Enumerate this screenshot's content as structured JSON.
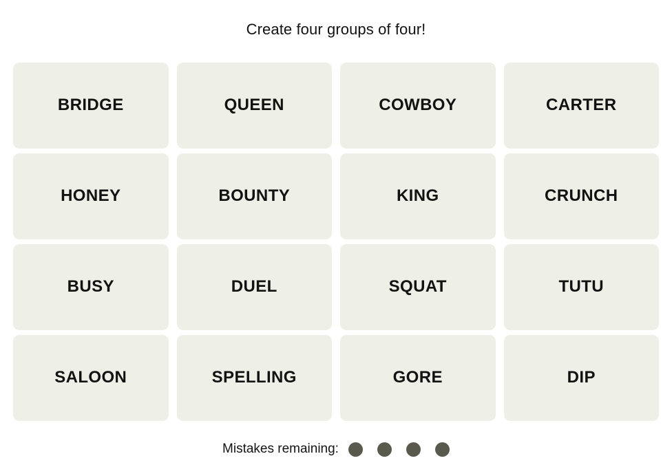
{
  "header": {
    "instruction": "Create four groups of four!"
  },
  "board": {
    "columns": 4,
    "rows": 4,
    "tile_bg_color": "#eeefe6",
    "tile_text_color": "#121212",
    "tiles": [
      {
        "word": "BRIDGE",
        "selected": false
      },
      {
        "word": "QUEEN",
        "selected": false
      },
      {
        "word": "COWBOY",
        "selected": false
      },
      {
        "word": "CARTER",
        "selected": false
      },
      {
        "word": "HONEY",
        "selected": false
      },
      {
        "word": "BOUNTY",
        "selected": false
      },
      {
        "word": "KING",
        "selected": false
      },
      {
        "word": "CRUNCH",
        "selected": false
      },
      {
        "word": "BUSY",
        "selected": false
      },
      {
        "word": "DUEL",
        "selected": false
      },
      {
        "word": "SQUAT",
        "selected": false
      },
      {
        "word": "TUTU",
        "selected": false
      },
      {
        "word": "SALOON",
        "selected": false
      },
      {
        "word": "SPELLING",
        "selected": false
      },
      {
        "word": "GORE",
        "selected": false
      },
      {
        "word": "DIP",
        "selected": false
      }
    ]
  },
  "footer": {
    "mistakes_label": "Mistakes remaining:",
    "mistakes_remaining": 4,
    "dot_color": "#5a594e",
    "dots": [
      {
        "icon": "filled-dot-icon"
      },
      {
        "icon": "filled-dot-icon"
      },
      {
        "icon": "filled-dot-icon"
      },
      {
        "icon": "filled-dot-icon"
      }
    ]
  }
}
